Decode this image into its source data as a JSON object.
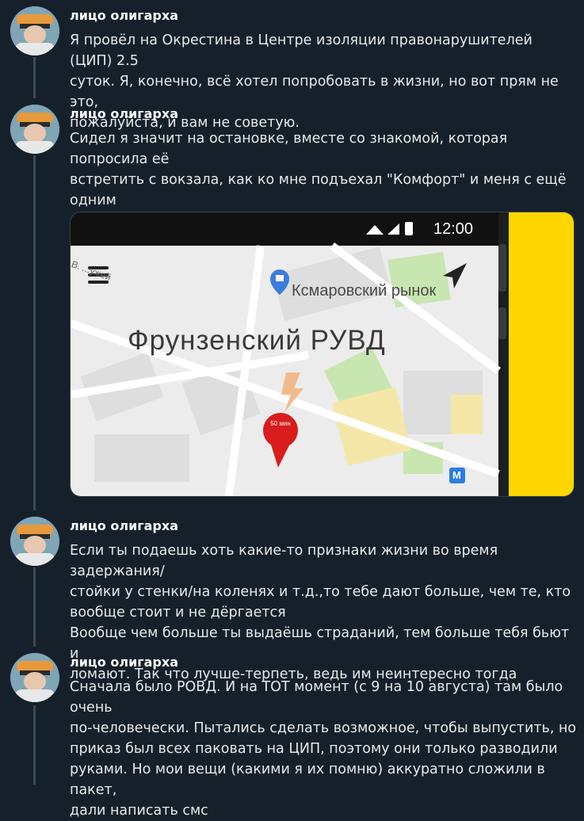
{
  "tweets": [
    {
      "author": "лицо олигарха",
      "text": "Я провёл на Окрестина в Центре изоляции правонарушителей (ЦИП) 2.5\nсуток. Я, конечно, всё хотел попробовать в жизни, но вот прям не это,\nпожалуйста, и вам не советую."
    },
    {
      "author": "лицо олигарха",
      "text": "Сидел я значит на остановке, вместе со знакомой, которая попросила её\nвстретить с вокзала, как ко мне подъехал \"Комфорт\" и меня с ещё одним\nмужчиной подхватили \"добры молодцы\" во всём чёрном и потащили в\nсалон. Самое главное в этой ситуации - расслабиться.",
      "media": {
        "status_time": "12:00",
        "street_label": "В. ...ужей",
        "poi_label": "Кс...маровский рынок",
        "poi_label_display": "Ксмаровский рынок",
        "district_label": "Фрунзенский РУВД",
        "pin_label": "50 мин",
        "metro_label": "M",
        "colors": {
          "pin": "#d91c1c",
          "side_panel": "#ffd600",
          "map_bg": "#ececec"
        }
      }
    },
    {
      "author": "лицо олигарха",
      "text": "Если ты подаешь хоть какие-то признаки жизни во время задержания/\nстойки у стенки/на коленях и т.д.,то тебе дают больше, чем те, кто\nвообще стоит и не дёргается\nВообще чем больше ты выдаёшь страданий, тем больше тебя бьют и\nломают. Так что лучше-терпеть, ведь им неинтересно тогда"
    },
    {
      "author": "лицо олигарха",
      "text": "Сначала было РОВД. И на ТОТ момент (с 9 на 10 августа) там было очень\nпо-человечески. Пытались сделать возможное, чтобы выпустить, но\nприказ был всех паковать на ЦИП, поэтому они только разводили\nруками. Но мои вещи (какими я их помню) аккуратно сложили в пакет,\nдали написать смс"
    }
  ]
}
